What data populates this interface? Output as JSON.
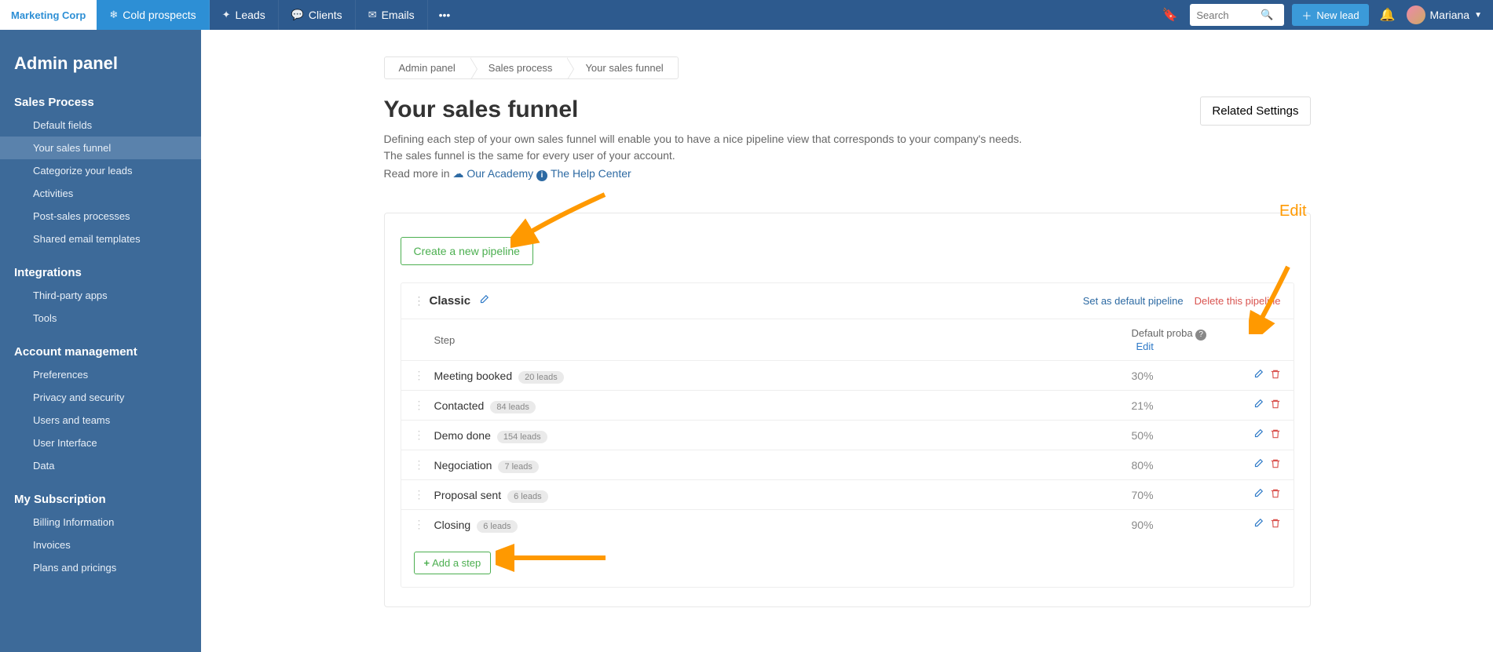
{
  "brand": "Marketing Corp",
  "nav": {
    "tabs": [
      {
        "label": "Cold prospects",
        "icon": "❄"
      },
      {
        "label": "Leads",
        "icon": "✦"
      },
      {
        "label": "Clients",
        "icon": "💬"
      },
      {
        "label": "Emails",
        "icon": "✉"
      }
    ],
    "search_placeholder": "Search",
    "new_lead_label": "New lead",
    "user_name": "Mariana"
  },
  "sidebar": {
    "title": "Admin panel",
    "sections": [
      {
        "title": "Sales Process",
        "items": [
          "Default fields",
          "Your sales funnel",
          "Categorize your leads",
          "Activities",
          "Post-sales processes",
          "Shared email templates"
        ],
        "active_index": 1
      },
      {
        "title": "Integrations",
        "items": [
          "Third-party apps",
          "Tools"
        ]
      },
      {
        "title": "Account management",
        "items": [
          "Preferences",
          "Privacy and security",
          "Users and teams",
          "User Interface",
          "Data"
        ]
      },
      {
        "title": "My Subscription",
        "items": [
          "Billing Information",
          "Invoices",
          "Plans and pricings"
        ]
      }
    ]
  },
  "breadcrumb": [
    "Admin panel",
    "Sales process",
    "Your sales funnel"
  ],
  "page": {
    "title": "Your sales funnel",
    "description": "Defining each step of your own sales funnel will enable you to have a nice pipeline view that corresponds to your company's needs. The sales funnel is the same for every user of your account.",
    "read_more_prefix": "Read more in ",
    "academy_link": "Our Academy",
    "help_link": "The Help Center",
    "related_settings": "Related Settings"
  },
  "create_pipeline": "Create a new pipeline",
  "edit_annotation": "Edit",
  "pipeline": {
    "name": "Classic",
    "set_default": "Set as default pipeline",
    "delete": "Delete this pipeline",
    "columns": {
      "step": "Step",
      "proba": "Default proba",
      "edit": "Edit"
    },
    "steps": [
      {
        "name": "Meeting booked",
        "leads": "20 leads",
        "proba": "30%"
      },
      {
        "name": "Contacted",
        "leads": "84 leads",
        "proba": "21%"
      },
      {
        "name": "Demo done",
        "leads": "154 leads",
        "proba": "50%"
      },
      {
        "name": "Negociation",
        "leads": "7 leads",
        "proba": "80%"
      },
      {
        "name": "Proposal sent",
        "leads": "6 leads",
        "proba": "70%"
      },
      {
        "name": "Closing",
        "leads": "6 leads",
        "proba": "90%"
      }
    ],
    "add_step": "Add a step"
  }
}
